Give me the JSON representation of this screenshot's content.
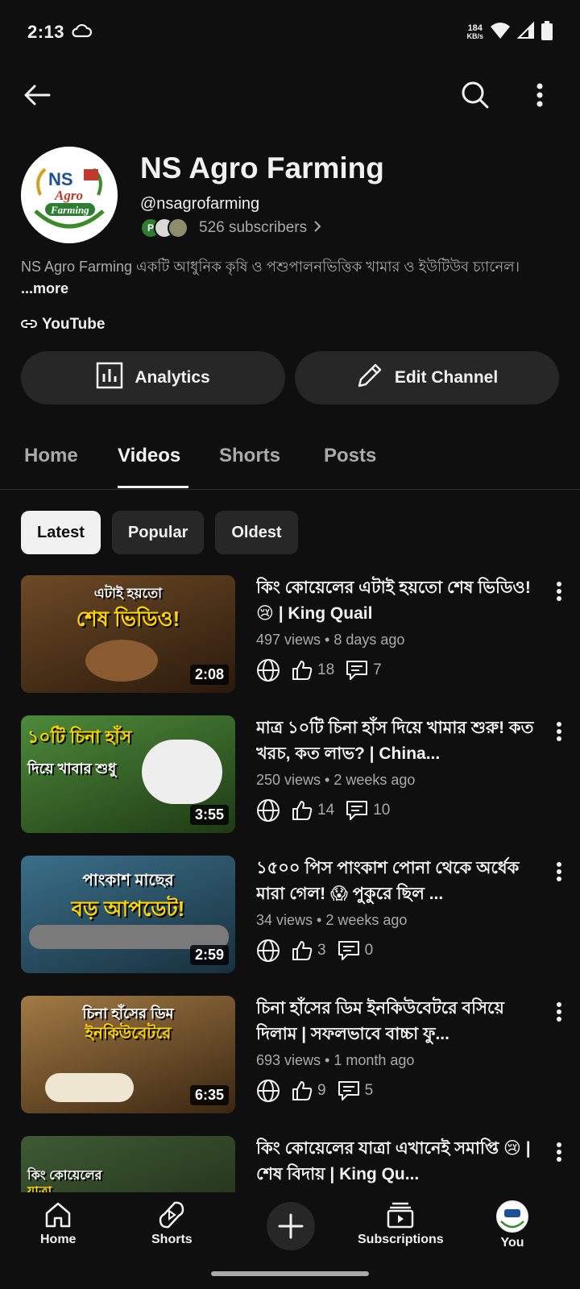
{
  "status": {
    "time": "2:13",
    "speed_top": "184",
    "speed_bottom": "KB/s"
  },
  "channel": {
    "name": "NS Agro Farming",
    "handle": "@nsagrofarming",
    "subscribers": "526 subscribers",
    "sub_avatar_letter": "P",
    "description": "NS Agro Farming একটি আধুনিক কৃষি ও পশুপালনভিত্তিক খামার ও ইউটিউব চ্যানেল।",
    "more_label": "...more",
    "link_label": "YouTube",
    "logo_text": {
      "top": "NS",
      "middle": "Agro",
      "bottom": "Farming"
    }
  },
  "actions": {
    "analytics_label": "Analytics",
    "edit_label": "Edit Channel"
  },
  "tabs": [
    {
      "label": "Home"
    },
    {
      "label": "Videos"
    },
    {
      "label": "Shorts"
    },
    {
      "label": "Posts"
    }
  ],
  "chips": [
    {
      "label": "Latest"
    },
    {
      "label": "Popular"
    },
    {
      "label": "Oldest"
    }
  ],
  "videos": [
    {
      "title": "কিং কোয়েলের এটাই হয়তো শেষ ভিডিও! 😢 | King Quail",
      "meta": "497 views • 8 days ago",
      "likes": "18",
      "comments": "7",
      "duration": "2:08",
      "thumb_line1": "এটাই হয়তো",
      "thumb_line2": "শেষ ভিডিও!",
      "thumb_bg": "#5a3a1c"
    },
    {
      "title": "মাত্র ১০টি চিনা হাঁস দিয়ে খামার শুরু! কত খরচ, কত লাভ? | China...",
      "meta": "250 views • 2 weeks ago",
      "likes": "14",
      "comments": "10",
      "duration": "3:55",
      "thumb_line1": "১০টি চিনা হাঁস",
      "thumb_line2": "দিয়ে খাবার শুধু",
      "thumb_bg": "#3f6b2a"
    },
    {
      "title": "১৫০০ পিস পাংকাশ পোনা থেকে অর্ধেক মারা গেল! 😱 পুকুরে ছিল ...",
      "meta": "34 views • 2 weeks ago",
      "likes": "3",
      "comments": "0",
      "duration": "2:59",
      "thumb_line1": "পাংকাশ মাছের",
      "thumb_line2": "বড় আপডেট!",
      "thumb_bg": "#2d4f63"
    },
    {
      "title": "চিনা হাঁসের ডিম ইনকিউবেটরে বসিয়ে দিলাম | সফলভাবে বাচ্চা ফু...",
      "meta": "693 views • 1 month ago",
      "likes": "9",
      "comments": "5",
      "duration": "6:35",
      "thumb_line1": "চিনা হাঁসের ডিম",
      "thumb_line2": "ইনকিউবেটরে",
      "thumb_bg": "#7a5a33"
    },
    {
      "title": "কিং কোয়েলের যাত্রা এখানেই সমাপ্তি 😢 | শেষ বিদায় | King Qu...",
      "meta": "",
      "likes": "",
      "comments": "",
      "duration": "",
      "thumb_line1": "কিং কোয়েলের",
      "thumb_line2": "যাত্রা",
      "thumb_bg": "#2f4a2a"
    }
  ],
  "nav": {
    "home": "Home",
    "shorts": "Shorts",
    "subscriptions": "Subscriptions",
    "you": "You"
  }
}
